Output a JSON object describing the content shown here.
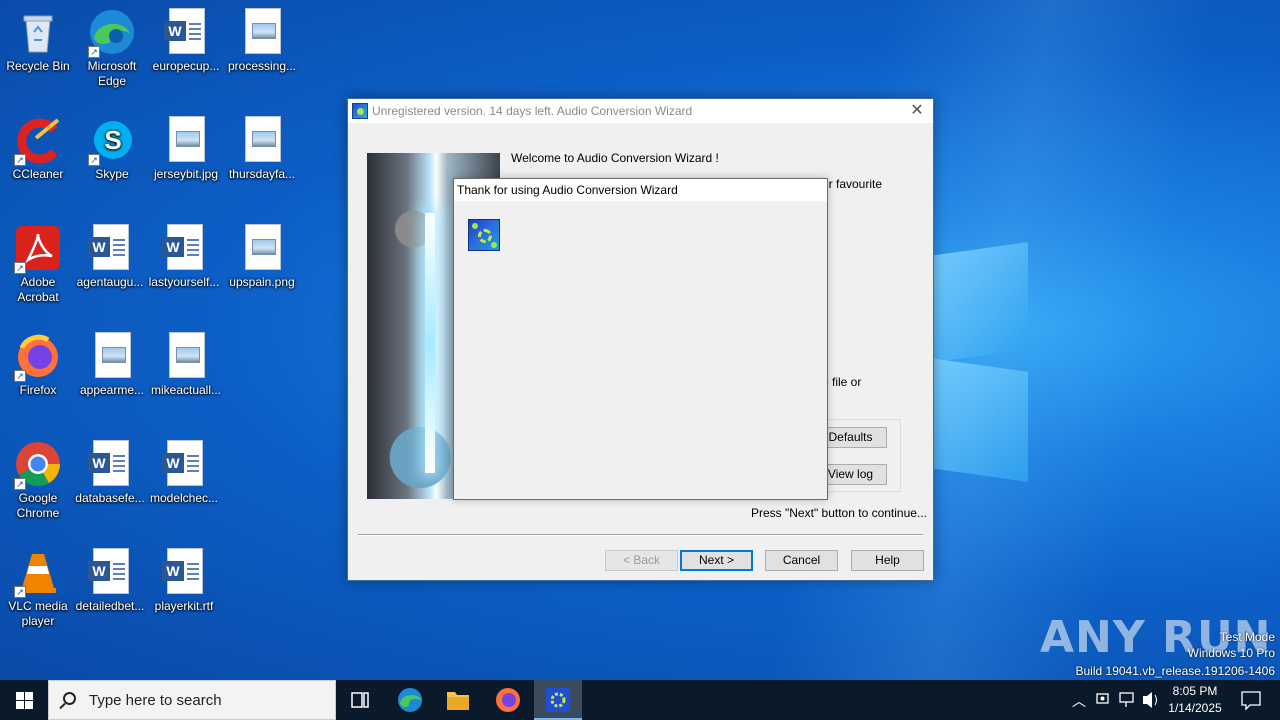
{
  "desktop": {
    "icons": [
      {
        "label": "Recycle Bin"
      },
      {
        "label": "Microsoft Edge"
      },
      {
        "label": "europecup..."
      },
      {
        "label": "processing..."
      },
      {
        "label": "CCleaner"
      },
      {
        "label": "Skype"
      },
      {
        "label": "jerseybit.jpg"
      },
      {
        "label": "thursdayfa..."
      },
      {
        "label": "Adobe Acrobat"
      },
      {
        "label": "agentaugu..."
      },
      {
        "label": "lastyourself..."
      },
      {
        "label": "upspain.png"
      },
      {
        "label": "Firefox"
      },
      {
        "label": "appearme..."
      },
      {
        "label": "mikeactuall..."
      },
      {
        "label": "Google Chrome"
      },
      {
        "label": "databasefe..."
      },
      {
        "label": "modelchec..."
      },
      {
        "label": "VLC media player"
      },
      {
        "label": "detailedbet..."
      },
      {
        "label": "playerkit.rtf"
      }
    ]
  },
  "wizard": {
    "title": "Unregistered version. 14 days left. Audio Conversion Wizard",
    "welcome": "Welcome to Audio Conversion Wizard !",
    "partial_text_1": "ur favourite",
    "partial_text_2": "o file or",
    "defaults_label": "Defaults",
    "viewlog_label": "View log",
    "press_next": "Press \"Next\" button to continue...",
    "back_label": "< Back",
    "next_label": "Next >",
    "cancel_label": "Cancel",
    "help_label": "Help"
  },
  "popup": {
    "title": "Thank for using Audio Conversion Wizard"
  },
  "watermark": {
    "brand": "ANY RUN",
    "line1": "Test Mode",
    "line2": "Windows 10 Pro",
    "line3": "Build 19041.vb_release.191206-1406"
  },
  "taskbar": {
    "search_placeholder": "Type here to search",
    "time": "8:05 PM",
    "date": "1/14/2025"
  },
  "colors": {
    "accent": "#0078d7",
    "taskbar": "#0b1a2b",
    "desktop": "#0c5fc6"
  }
}
